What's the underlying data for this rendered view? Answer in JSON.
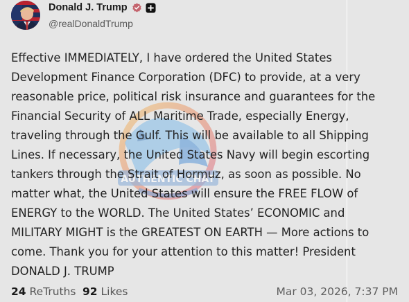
{
  "post": {
    "author": {
      "display_name": "Donald J. Trump",
      "handle": "@realDonaldTrump",
      "verified_color": "#c0606a"
    },
    "text": "Effective IMMEDIATELY, I have ordered the United States\nDevelopment Finance Corporation (DFC) to provide, at a very\nreasonable price, political risk insurance and guarantees for the\nFinancial Security of ALL Maritime Trade, especially Energy,\ntraveling through the Gulf. This will be available to all Shipping\nLines. If necessary, the United States Navy will begin escorting\ntankers through the Strait of Hormuz, as soon as possible. No\nmatter what, the United States will ensure the FREE FLOW of\nENERGY to the WORLD. The United States’ ECONOMIC and\nMILITARY MIGHT is the GREATEST ON EARTH — More actions to\ncome. Thank you for your attention to this matter! President\nDONALD J. TRUMP",
    "stats": {
      "retruths_count": "24",
      "retruths_label": "ReTruths",
      "likes_count": "92",
      "likes_label": "Likes"
    },
    "timestamp": "Mar 03, 2026, 7:37 PM"
  },
  "watermark": {
    "text": "AUTHENTIC CHAT"
  }
}
